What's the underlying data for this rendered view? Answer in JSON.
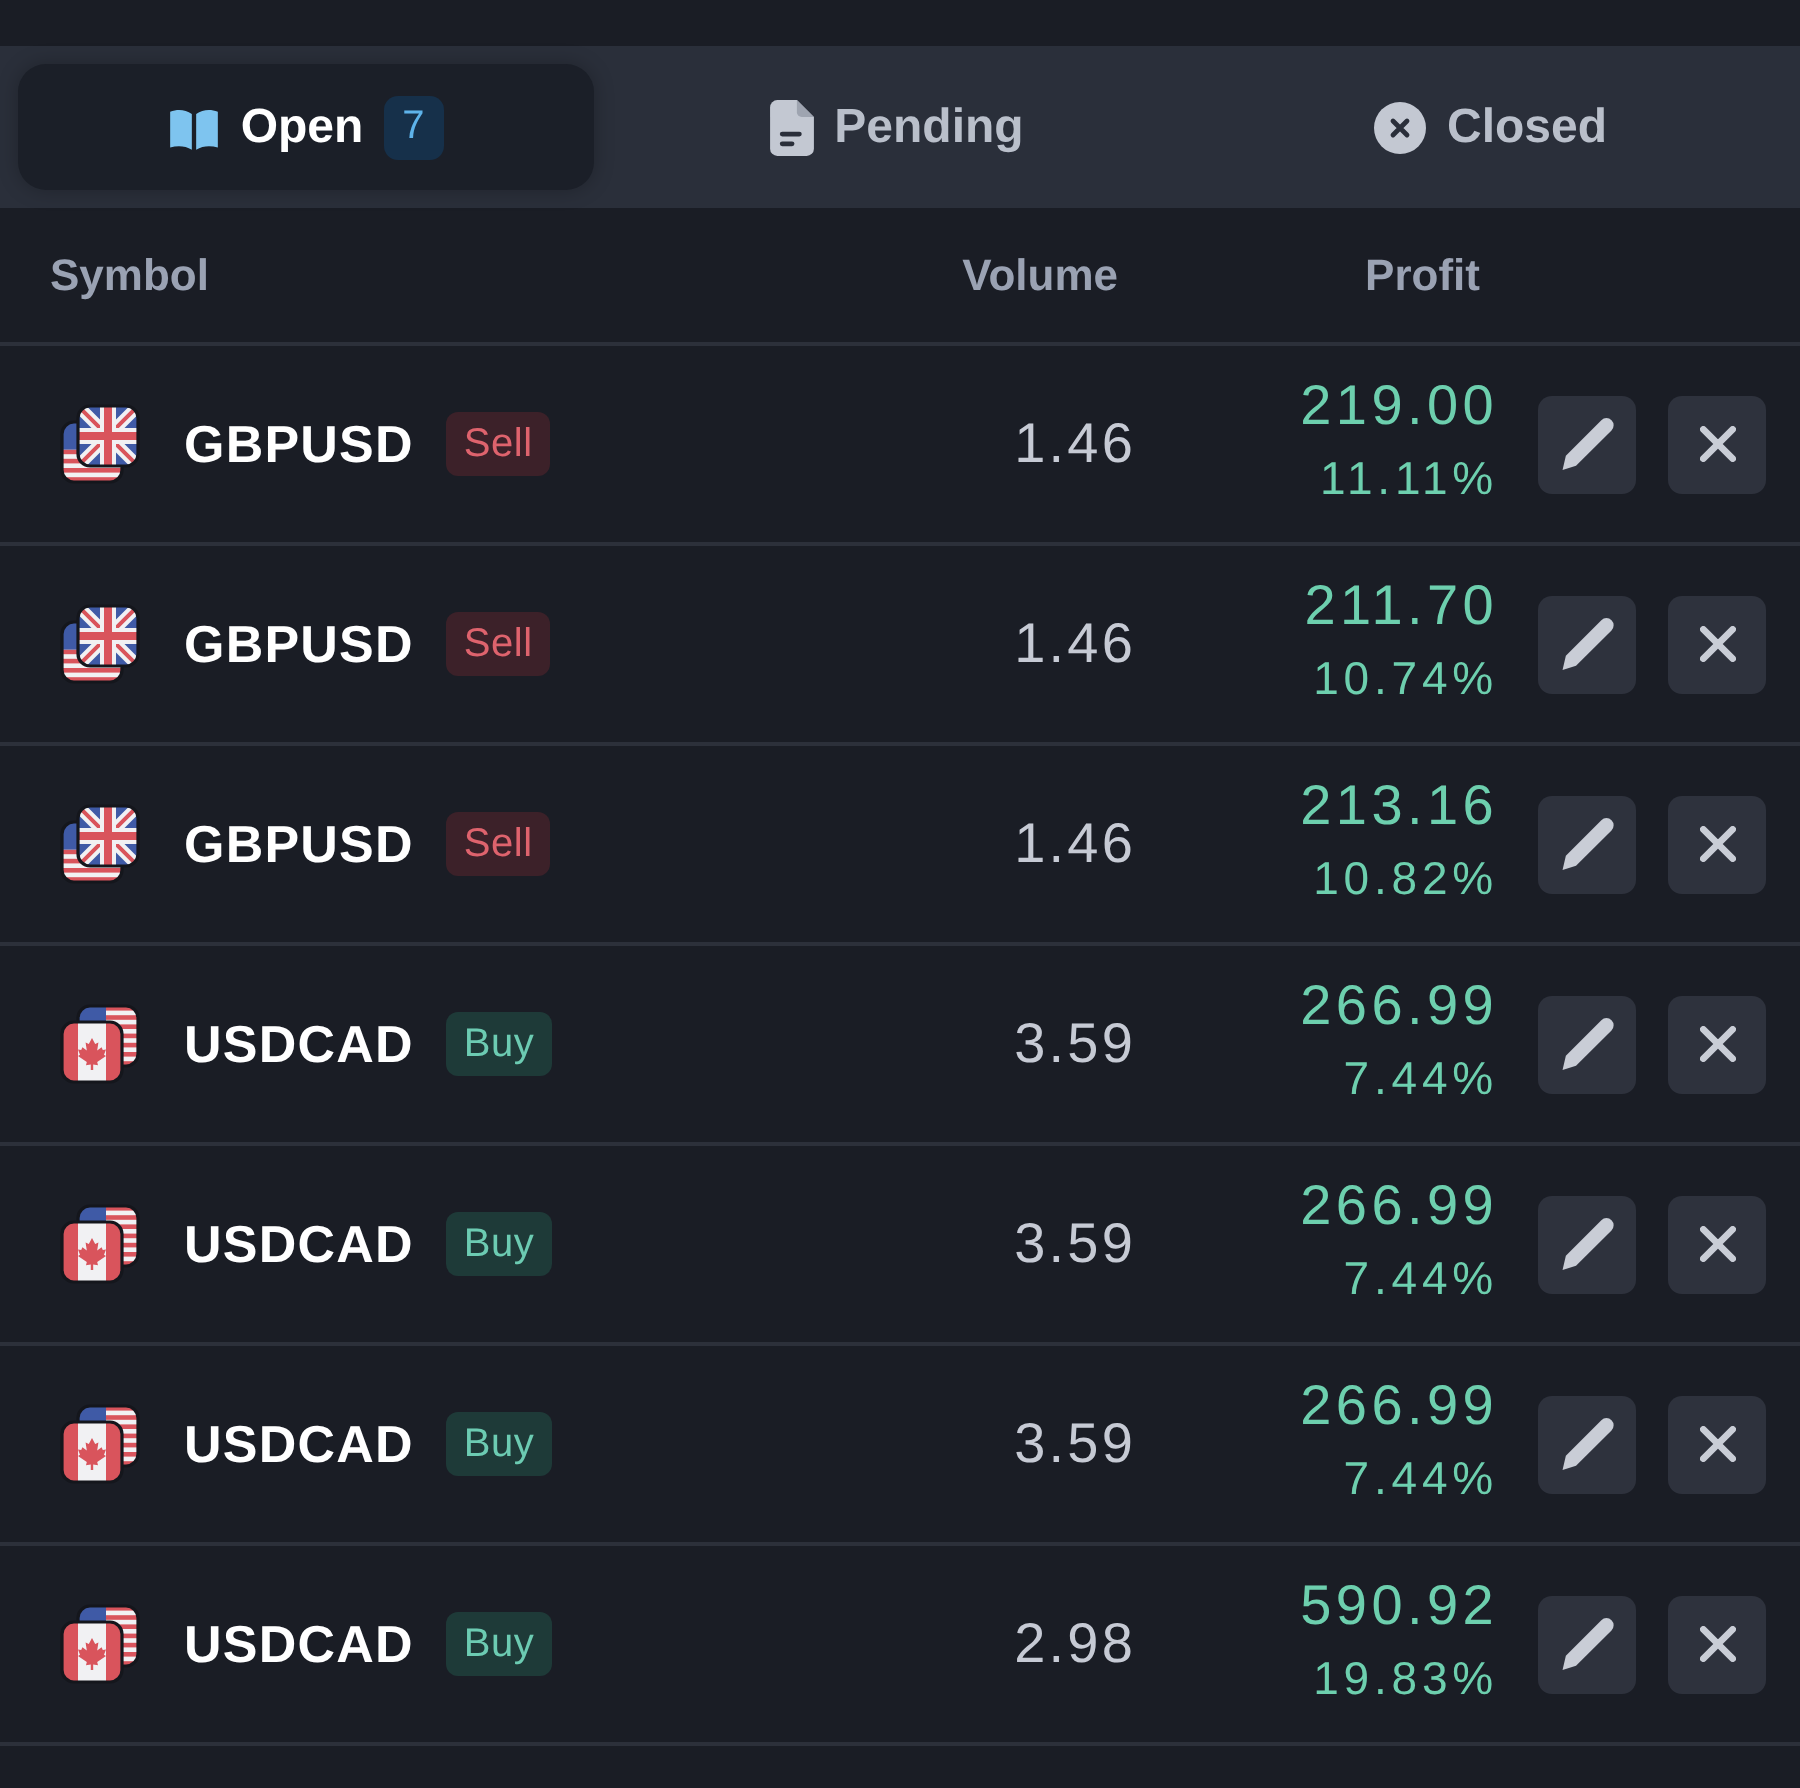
{
  "tabs": [
    {
      "label": "Open",
      "count": "7",
      "selected": true
    },
    {
      "label": "Pending",
      "selected": false
    },
    {
      "label": "Closed",
      "selected": false
    }
  ],
  "table": {
    "columns": [
      "Symbol",
      "Volume",
      "Profit"
    ],
    "rows": [
      {
        "kind": "gbpusd",
        "symbol": "GBPUSD",
        "side": {
          "label": "Sell",
          "kind": "sell"
        },
        "volume": "1.46",
        "profit": "219.00",
        "profit_percent": "11.11%"
      },
      {
        "kind": "gbpusd",
        "symbol": "GBPUSD",
        "side": {
          "label": "Sell",
          "kind": "sell"
        },
        "volume": "1.46",
        "profit": "211.70",
        "profit_percent": "10.74%"
      },
      {
        "kind": "gbpusd",
        "symbol": "GBPUSD",
        "side": {
          "label": "Sell",
          "kind": "sell"
        },
        "volume": "1.46",
        "profit": "213.16",
        "profit_percent": "10.82%"
      },
      {
        "kind": "usdcad",
        "symbol": "USDCAD",
        "side": {
          "label": "Buy",
          "kind": "buy"
        },
        "volume": "3.59",
        "profit": "266.99",
        "profit_percent": "7.44%"
      },
      {
        "kind": "usdcad",
        "symbol": "USDCAD",
        "side": {
          "label": "Buy",
          "kind": "buy"
        },
        "volume": "3.59",
        "profit": "266.99",
        "profit_percent": "7.44%"
      },
      {
        "kind": "usdcad",
        "symbol": "USDCAD",
        "side": {
          "label": "Buy",
          "kind": "buy"
        },
        "volume": "3.59",
        "profit": "266.99",
        "profit_percent": "7.44%"
      },
      {
        "kind": "usdcad",
        "symbol": "USDCAD",
        "side": {
          "label": "Buy",
          "kind": "buy"
        },
        "volume": "2.98",
        "profit": "590.92",
        "profit_percent": "19.83%"
      }
    ]
  }
}
